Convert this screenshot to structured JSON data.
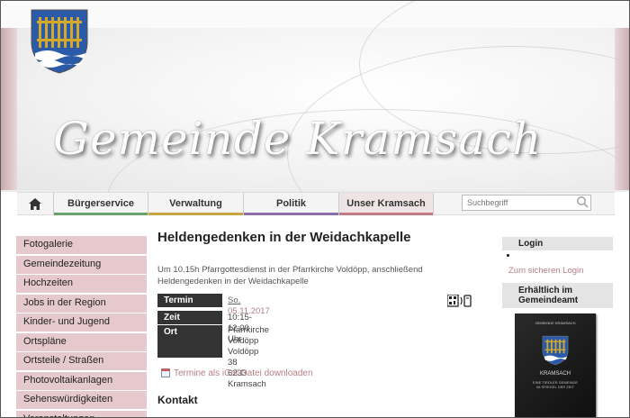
{
  "site": {
    "title": "Gemeinde Kramsach"
  },
  "nav": {
    "items": [
      {
        "label": "Bürgerservice",
        "color": "#6aa36a"
      },
      {
        "label": "Verwaltung",
        "color": "#c9a545"
      },
      {
        "label": "Politik",
        "color": "#8a6fa8"
      },
      {
        "label": "Unser Kramsach",
        "color": "#c47a85"
      }
    ],
    "search_placeholder": "Suchbegriff"
  },
  "sidebar": {
    "items": [
      "Fotogalerie",
      "Gemeindezeitung",
      "Hochzeiten",
      "Jobs in der Region",
      "Kinder- und Jugend",
      "Ortspläne",
      "Ortsteile / Straßen",
      "Photovoltaikanlagen",
      "Sehenswürdigkeiten",
      "Veranstaltungen"
    ]
  },
  "article": {
    "title": "Heldengedenken in der Weidachkapelle",
    "lead": "Um 10.15h Pfarrgottesdienst in der Pfarrkirche Voldöpp, anschließend Heldengedenken in der Weidachkapelle",
    "termin_label": "Termin",
    "termin_day": "So,",
    "termin_date": "05.11.2017",
    "zeit_label": "Zeit",
    "zeit_value": "10:15-12:00 Uhr",
    "ort_label": "Ort",
    "ort_lines": [
      "Pfarrkirche Voldöpp",
      "Voldöpp 38",
      "6233 Kramsach"
    ],
    "ical_link": "Termine als iCal-Datei downloaden",
    "kontakt": "Kontakt"
  },
  "right": {
    "login_title": "Login",
    "login_link": "Zum sicheren Login",
    "book_title": "Erhältlich im Gemeindeamt",
    "book_top": "GEMEINDE KRAMSACH",
    "book_name": "KRAMSACH",
    "book_sub": [
      "EINE TIROLER GEMEINDE",
      "IM SPIEGEL DER ZEIT"
    ]
  },
  "colors": {
    "accent": "#b57e86",
    "sidebar_bg": "#e6c9cc",
    "label_bg": "#333333"
  }
}
